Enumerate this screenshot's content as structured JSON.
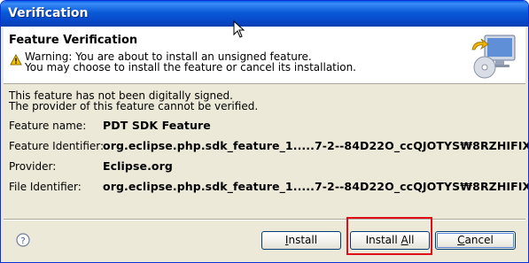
{
  "window": {
    "title": "Verification"
  },
  "header": {
    "title": "Feature Verification",
    "warning_line1": "Warning: You are about to install an unsigned feature.",
    "warning_line2": "You may choose to install the feature or cancel its installation."
  },
  "content": {
    "note_line1": "This feature has not been digitally signed.",
    "note_line2": "The provider of this feature cannot be verified.",
    "rows": [
      {
        "label": "Feature name:",
        "value": "PDT SDK Feature"
      },
      {
        "label": "Feature Identifier:",
        "value": "org.eclipse.php.sdk_feature_1.....7-2--84D22O_ccQJOTYS₩8RZHIFIXR"
      },
      {
        "label": "Provider:",
        "value": "Eclipse.org"
      },
      {
        "label": "File Identifier:",
        "value": "org.eclipse.php.sdk_feature_1.....7-2--84D22O_ccQJOTYS₩8RZHIFIXR"
      }
    ]
  },
  "buttons": {
    "install_pre": "",
    "install_key": "I",
    "install_post": "nstall",
    "installall_pre": "Install ",
    "installall_key": "A",
    "installall_post": "ll",
    "cancel_pre": "",
    "cancel_key": "C",
    "cancel_post": "ancel"
  },
  "icons": {
    "help": "help-icon",
    "warning": "warning-icon",
    "banner": "install-wizard-icon"
  },
  "colors": {
    "titlebar": "#0a5ad8",
    "highlight": "#e0101a",
    "dialog_bg": "#ece9d8"
  }
}
